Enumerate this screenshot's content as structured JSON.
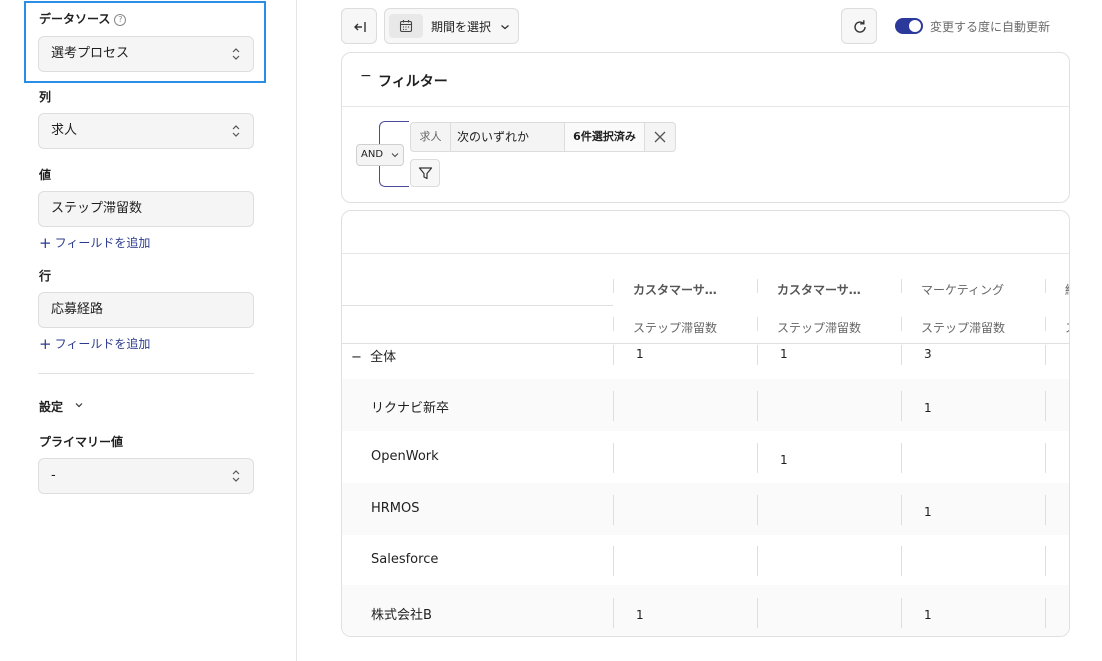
{
  "left_panel": {
    "datasource": {
      "label": "データソース",
      "help": "?",
      "value": "選考プロセス"
    },
    "columns": {
      "label": "列",
      "value": "求人"
    },
    "values": {
      "label": "値",
      "value": "ステップ滞留数",
      "add_field": "フィールドを追加"
    },
    "rows": {
      "label": "行",
      "value": "応募経路",
      "add_field": "フィールドを追加"
    },
    "settings": {
      "label": "設定"
    },
    "primary_value": {
      "label": "プライマリー値",
      "value": "-"
    }
  },
  "toolbar": {
    "period_label": "期間を選択",
    "auto_update_label": "変更する度に自動更新",
    "auto_update_on": true
  },
  "filter": {
    "title": "フィルター",
    "logic": "AND",
    "condition": {
      "field": "求人",
      "operator": "次のいずれか",
      "value": "6件選択済み"
    }
  },
  "table": {
    "columns": [
      {
        "name": "カスタマーサ…",
        "measure": "ステップ滞留数"
      },
      {
        "name": "カスタマーサ…",
        "measure": "ステップ滞留数"
      },
      {
        "name": "マーケティング",
        "measure": "ステップ滞留数"
      },
      {
        "name": "経",
        "measure": "ス"
      }
    ],
    "total_row": {
      "label": "全体",
      "values": [
        "1",
        "1",
        "3",
        ""
      ]
    },
    "rows": [
      {
        "label": "リクナビ新卒",
        "values": [
          "",
          "",
          "1",
          ""
        ]
      },
      {
        "label": "OpenWork",
        "values": [
          "",
          "1",
          "",
          ""
        ]
      },
      {
        "label": "HRMOS",
        "values": [
          "",
          "",
          "1",
          ""
        ]
      },
      {
        "label": "Salesforce",
        "values": [
          "",
          "",
          "",
          ""
        ]
      },
      {
        "label": "株式会社B",
        "values": [
          "1",
          "",
          "1",
          ""
        ]
      }
    ]
  },
  "colors": {
    "accent": "#2b3a9a",
    "highlight": "#2a8de8",
    "link": "#2b3a8f"
  }
}
